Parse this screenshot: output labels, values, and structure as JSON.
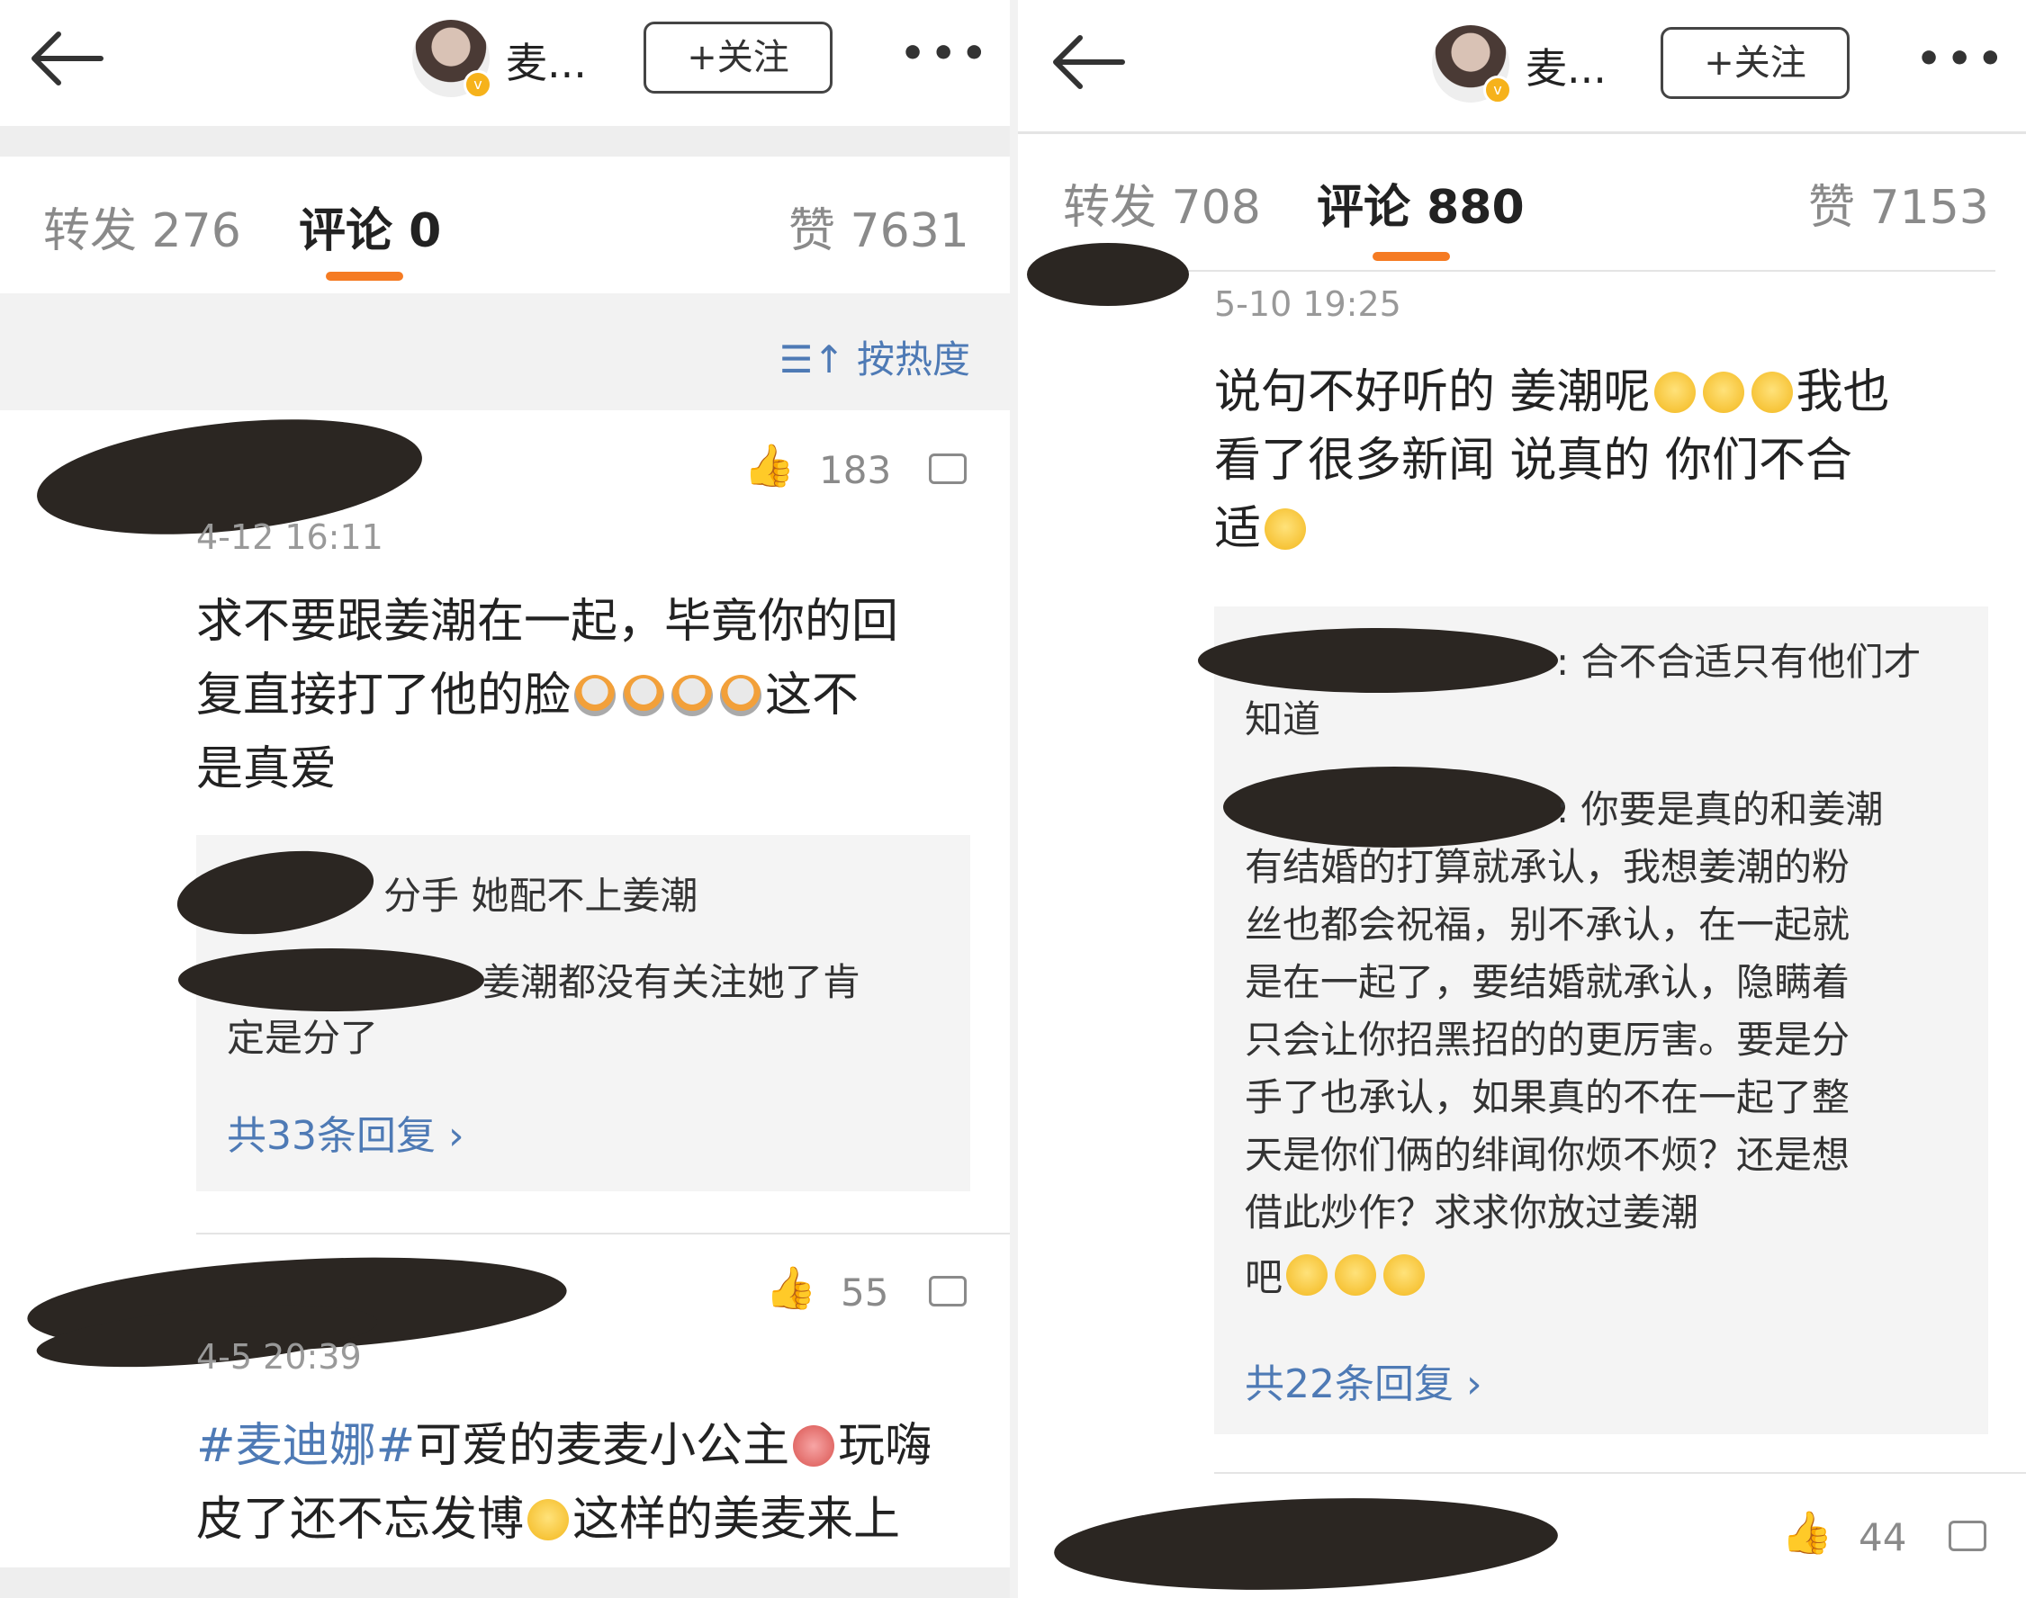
{
  "left": {
    "header": {
      "username": "麦...",
      "follow_label": "+关注",
      "more_label": "•••"
    },
    "tabs": {
      "repost": "转发 276",
      "comments": "评论 0",
      "likes": "赞 7631"
    },
    "sort_label": "按热度",
    "comments": [
      {
        "likes": "183",
        "time": "4-12 16:11",
        "text_lines": [
          "求不要跟姜潮在一起，毕竟你的回",
          "复直接打了他的脸",
          "这不",
          "是真爱"
        ],
        "replies": [
          {
            "text": "分手 她配不上姜潮"
          },
          {
            "text": "姜潮都没有关注她了肯",
            "text2": "定是分了"
          }
        ],
        "more_replies": "共33条回复 ›"
      },
      {
        "likes": "55",
        "time": "4-5 20:39",
        "tag": "#麦迪娜#",
        "text_line1": "可爱的麦麦小公主",
        "text_line1b": "玩嗨",
        "text_line2": "皮了还不忘发博",
        "text_line2b": "这样的美麦来上"
      }
    ]
  },
  "right": {
    "header": {
      "username": "麦...",
      "follow_label": "+关注",
      "more_label": "•••"
    },
    "tabs": {
      "repost": "转发 708",
      "comments": "评论 880",
      "likes": "赞 7153"
    },
    "comments": [
      {
        "time": "5-10 19:25",
        "line1": "说句不好听的 姜潮呢",
        "line1b": "我也",
        "line2": "看了很多新闻 说真的 你们不合",
        "line3": "适",
        "replies": [
          {
            "lines": [
              ": 合不合适只有他们才",
              "知道"
            ]
          },
          {
            "lines": [
              ": 你要是真的和姜潮",
              "有结婚的打算就承认，我想姜潮的粉",
              "丝也都会祝福，别不承认，在一起就",
              "是在一起了，要结婚就承认，隐瞒着",
              "只会让你招黑招的的更厉害。要是分",
              "手了也承认，如果真的不在一起了整",
              "天是你们俩的绯闻你烦不烦？还是想",
              "借此炒作？求求你放过姜潮",
              "吧"
            ]
          }
        ],
        "more_replies": "共22条回复 ›"
      },
      {
        "likes": "44"
      }
    ]
  }
}
